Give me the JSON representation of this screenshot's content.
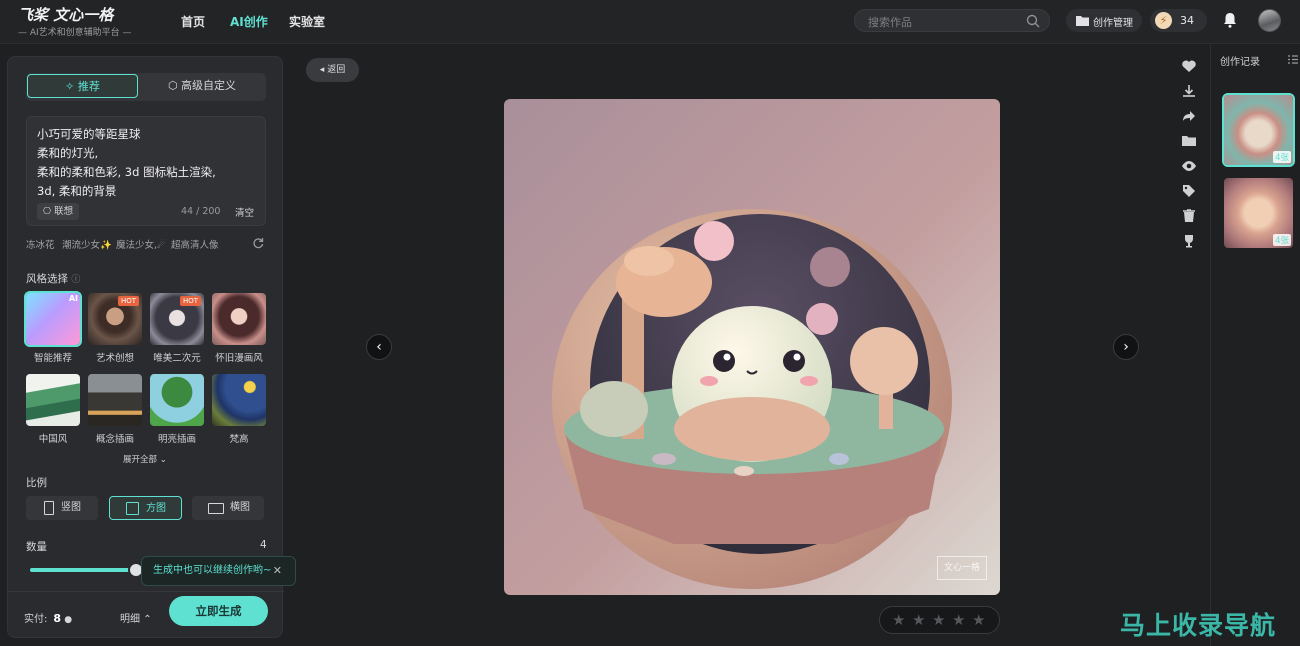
{
  "brand": {
    "logo_title": "飞桨 文心一格",
    "logo_subtitle": "— AI艺术和创意辅助平台 —"
  },
  "nav": {
    "items": [
      "首页",
      "AI创作",
      "实验室"
    ],
    "active": "AI创作"
  },
  "header": {
    "search_placeholder": "搜索作品",
    "manage_label": "创作管理",
    "coin_count": "34"
  },
  "left": {
    "tab_recommend": "推荐",
    "tab_custom": "高级自定义",
    "prompt_text": "小巧可爱的等距星球\n柔和的灯光,\n柔和的柔和色彩, 3d 图标粘土渲染,\n3d, 柔和的背景",
    "associate_label": "联想",
    "char_count": "44 / 200",
    "clear_label": "清空",
    "suggestions": [
      "冻冰花",
      "潮流少女✨",
      "魔法少女,☄",
      "超高清人像"
    ],
    "style_title": "风格选择",
    "styles": [
      {
        "label": "智能推荐",
        "badge": "AI"
      },
      {
        "label": "艺术创想",
        "badge": "HOT"
      },
      {
        "label": "唯美二次元",
        "badge": "HOT"
      },
      {
        "label": "怀旧漫画风",
        "badge": ""
      },
      {
        "label": "中国风",
        "badge": ""
      },
      {
        "label": "概念插画",
        "badge": ""
      },
      {
        "label": "明亮插画",
        "badge": ""
      },
      {
        "label": "梵高",
        "badge": ""
      }
    ],
    "expand_label": "展开全部",
    "ratio_title": "比例",
    "ratios": [
      "竖图",
      "方图",
      "横图"
    ],
    "ratio_selected": "方图",
    "quantity_title": "数量",
    "quantity_value": "4",
    "quantity_fraction": 0.44,
    "paid_label": "实付:",
    "paid_value": "8",
    "detail_label": "明细",
    "generate_label": "立即生成",
    "toast_text": "生成中也可以继续创作哟~"
  },
  "main": {
    "back_label": "返回",
    "watermark": "文心一格",
    "rating_max": 5,
    "rating_value": 0
  },
  "right": {
    "title": "创作记录",
    "records": [
      {
        "count": "4张"
      },
      {
        "count": "4张"
      }
    ]
  },
  "footer_watermark": "马上收录导航",
  "colors": {
    "accent": "#5fe1d2",
    "background": "#1f2022",
    "panel": "#2a2b2e"
  }
}
